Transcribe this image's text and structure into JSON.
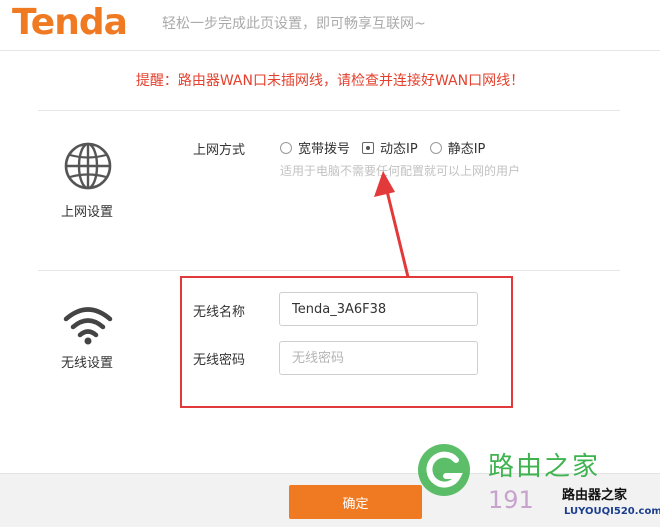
{
  "header": {
    "logo": "Tenda",
    "tagline": "轻松一步完成此页设置，即可畅享互联网~"
  },
  "warning": "提醒：路由器WAN口未插网线，请检查并连接好WAN口网线！",
  "wan_section": {
    "label": "上网设置",
    "field_label": "上网方式",
    "options": [
      "宽带拨号",
      "动态IP",
      "静态IP"
    ],
    "selected": "动态IP",
    "hint": "适用于电脑不需要任何配置就可以上网的用户"
  },
  "wireless_section": {
    "label": "无线设置",
    "ssid_label": "无线名称",
    "ssid_value": "Tenda_3A6F38",
    "password_label": "无线密码",
    "password_placeholder": "无线密码"
  },
  "footer": {
    "ok_label": "确定"
  },
  "watermark": {
    "line1": "路由之家",
    "line2": "191",
    "line3": "路由器之家",
    "line4": "LUYOUQI520.com"
  },
  "colors": {
    "brand": "#f07a21",
    "warning": "#e4412e",
    "annotation": "#e23a3a"
  }
}
